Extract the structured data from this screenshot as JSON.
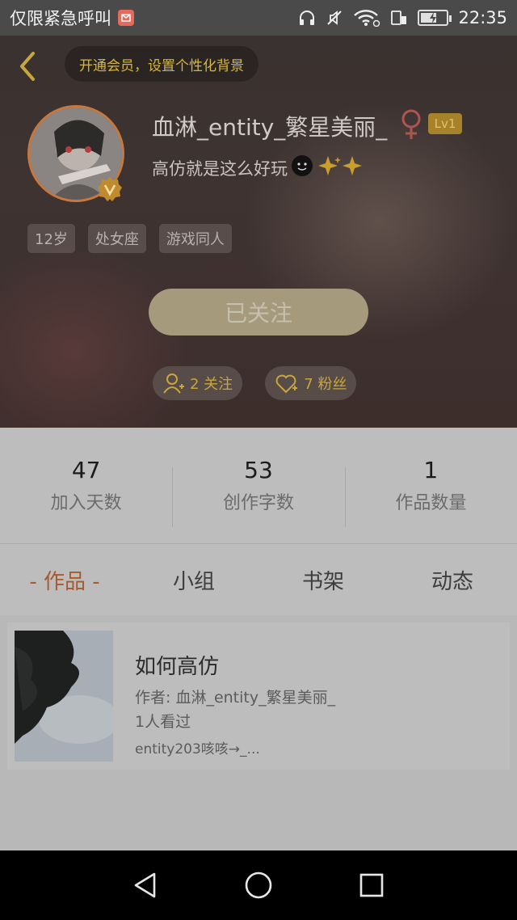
{
  "status_bar": {
    "left_text": "仅限紧急呼叫",
    "time": "22:35",
    "battery_level": 0.62
  },
  "header": {
    "vip_prompt": "开通会员，设置个性化背景",
    "username": "血淋_entity_繁星美丽_",
    "level": "Lv1",
    "bio": "高仿就是这么好玩",
    "tags": [
      "12岁",
      "处女座",
      "游戏同人"
    ],
    "follow_button": "已关注",
    "following_label": "2 关注",
    "fans_label": "7 粉丝"
  },
  "stats": [
    {
      "value": "47",
      "label": "加入天数"
    },
    {
      "value": "53",
      "label": "创作字数"
    },
    {
      "value": "1",
      "label": "作品数量"
    }
  ],
  "tabs": [
    {
      "label": "- 作品 -",
      "active": true
    },
    {
      "label": "小组",
      "active": false
    },
    {
      "label": "书架",
      "active": false
    },
    {
      "label": "动态",
      "active": false
    }
  ],
  "works": [
    {
      "title": "如何高仿",
      "author": "作者: 血淋_entity_繁星美丽_",
      "views": "1人看过",
      "excerpt": "entity203咳咳→_..."
    }
  ],
  "colors": {
    "accent_gold": "#d7b73a",
    "active_tab": "#a85a2d",
    "level_badge": "#a6832b"
  }
}
